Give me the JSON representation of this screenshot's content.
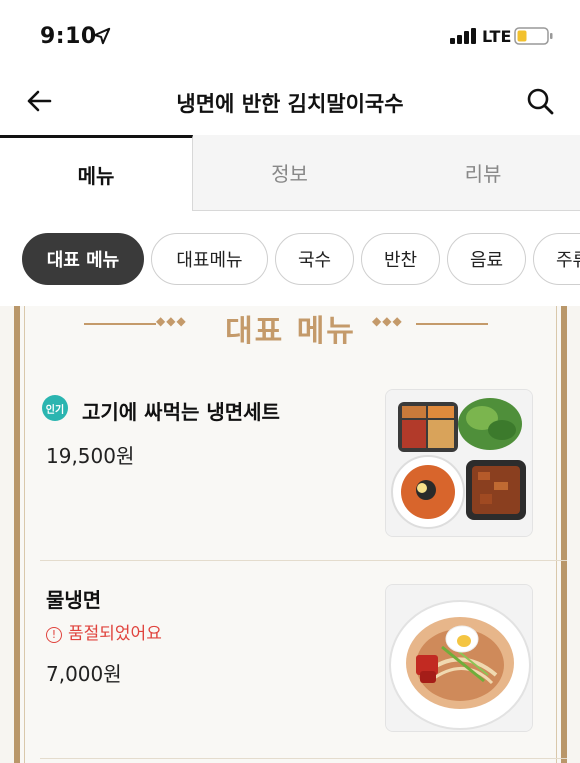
{
  "status_bar": {
    "time": "9:10",
    "network": "LTE"
  },
  "header": {
    "title": "냉면에 반한 김치말이국수"
  },
  "tabs": [
    {
      "label": "메뉴",
      "active": true
    },
    {
      "label": "정보",
      "active": false
    },
    {
      "label": "리뷰",
      "active": false
    }
  ],
  "chips": [
    {
      "label": "대표 메뉴",
      "active": true
    },
    {
      "label": "대표메뉴",
      "active": false
    },
    {
      "label": "국수",
      "active": false
    },
    {
      "label": "반찬",
      "active": false
    },
    {
      "label": "음료",
      "active": false
    },
    {
      "label": "주류",
      "active": false
    }
  ],
  "section": {
    "title": "대표 메뉴"
  },
  "menu_items": [
    {
      "badge": "인기",
      "name": "고기에 싸먹는 냉면세트",
      "price": "19,500원"
    },
    {
      "name": "물냉면",
      "status": "품절되었어요",
      "status_icon": "!",
      "price": "7,000원"
    }
  ],
  "colors": {
    "accent_brown": "#c49a6a",
    "board_border": "#b9976a",
    "badge_teal": "#2bb5b0",
    "soldout_red": "#e0443e",
    "chip_active": "#3a3a3a"
  }
}
